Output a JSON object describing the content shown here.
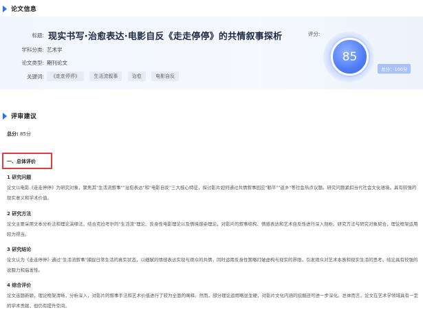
{
  "section1": {
    "title": "论文信息"
  },
  "info": {
    "title_label": "标题:",
    "title": "现实书写·治愈表达·电影自反《走走停停》的共情叙事探析",
    "category_label": "学科分类:",
    "category": "艺术学",
    "type_label": "论文类型:",
    "type": "期刊论文",
    "keywords_label": "关键词:",
    "keywords": [
      "《走走停停》",
      "生活流叙事",
      "治愈",
      "电影自反"
    ]
  },
  "score": {
    "label": "评分:",
    "value": "85",
    "total": "总分：100分"
  },
  "section2": {
    "title": "评审建议"
  },
  "total_line": {
    "label": "总分:",
    "value": "85分"
  },
  "overall": {
    "title": "一、总体评价"
  },
  "items": [
    {
      "heading": "1 研究问题",
      "text": "论文以电影《走走停停》为研究对象，聚焦其\"生活流叙事\"\"治愈表达\"和\"电影自反\"三大核心特征，探讨影片如何通过共情叙事回应\"躺平\"\"返乡\"等社会热点议题。研究问题紧扣当代社会文化语境，具有较强的现实意义和学术价值。"
    },
    {
      "heading": "2 研究方法",
      "text": "论文主要采用文本分析法和理论演绎法，结合克拉考尔的\"生活流\"理论、反身性电影理论以及情境感染理论，对影片的叙事结构、情感表达和艺术自反性进行深入剖析。研究方法与研究对象契合，理论框架运用较为得当。"
    },
    {
      "heading": "3 研究结论",
      "text": "论文认为《走走停停》通过\"生活流叙事\"捕捉日常生活的真实状态，以细腻的情感表达实现与观众的共情，同时运用反身性策略打破虚构与现实的界限，引发观众对艺术本质和现实生活的思考。结论具有较强的说服力和启发性。"
    },
    {
      "heading": "4 综合评价",
      "text": "论文选题新颖，理论框架清晰，分析深入，对影片的叙事手法和艺术价值进行了较为全面的阐释。然而，部分理论运用略显生硬，对影片文化内涵的挖掘还可进一步深化。总体而言，论文在艺术学领域具有一定的学术贡献，但仍有提升空间。"
    }
  ]
}
